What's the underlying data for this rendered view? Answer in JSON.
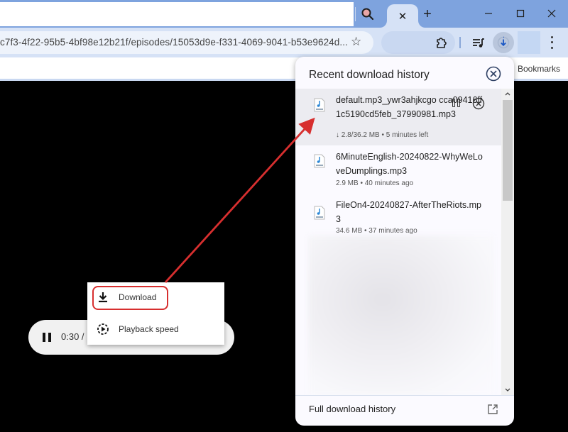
{
  "browser": {
    "url": "c7f3-4f22-95b5-4bf98e12b21f/episodes/15053d9e-f331-4069-9041-b53e9624d...",
    "bookmarks_label": "Bookmarks",
    "tab_close": "✕",
    "new_tab": "+",
    "window_controls": {
      "minimize": "—",
      "maximize": "☐",
      "close": "✕"
    },
    "star": "☆"
  },
  "download_panel": {
    "title": "Recent download history",
    "items": [
      {
        "name": "default.mp3_ywr3ahjkcgo cca09416ff1c5190cd5feb_37990981.mp3",
        "meta": "↓ 2.8/36.2 MB • 5 minutes left",
        "state": "in-progress"
      },
      {
        "name": "6MinuteEnglish-20240822-WhyWeLoveDumplings.mp3",
        "meta": "2.9 MB • 40 minutes ago",
        "state": "complete"
      },
      {
        "name": "FileOn4-20240827-AfterTheRiots.mp3",
        "meta": "34.6 MB • 37 minutes ago",
        "state": "complete"
      }
    ],
    "footer_label": "Full download history",
    "scroll_up": "▲",
    "scroll_down": "▼"
  },
  "player": {
    "time": "0:30 /",
    "menu": [
      {
        "label": "Download",
        "icon": "download-icon"
      },
      {
        "label": "Playback speed",
        "icon": "playback-speed-icon"
      }
    ]
  },
  "annotation": {
    "color": "#d72f2f"
  }
}
